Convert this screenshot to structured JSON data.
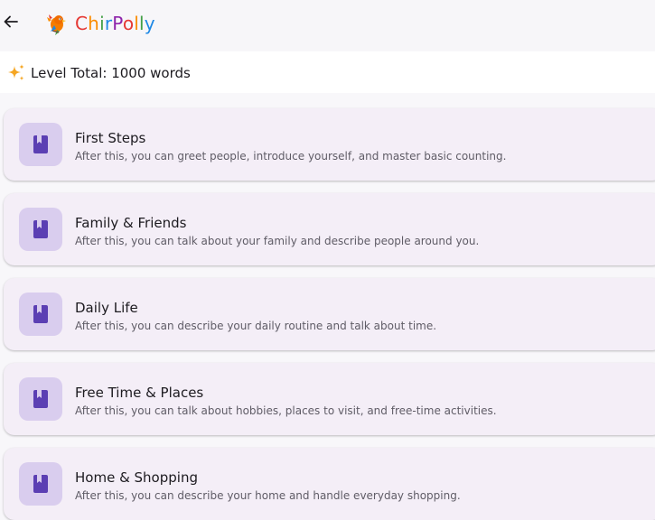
{
  "header": {
    "back_icon": "arrow-left-icon",
    "logo_icon": "parrot-logo-icon",
    "brand_letters": [
      {
        "char": "C",
        "color": "#e53935"
      },
      {
        "char": "h",
        "color": "#fb8c00"
      },
      {
        "char": "i",
        "color": "#43a047"
      },
      {
        "char": "r",
        "color": "#1e88e5"
      },
      {
        "char": "P",
        "color": "#8e24aa"
      },
      {
        "char": "o",
        "color": "#e53935"
      },
      {
        "char": "l",
        "color": "#fb8c00"
      },
      {
        "char": "l",
        "color": "#43a047"
      },
      {
        "char": "y",
        "color": "#1e88e5"
      }
    ]
  },
  "level": {
    "icon": "sparkle-icon",
    "text": "Level Total: 1000 words"
  },
  "colors": {
    "accent": "#5b3fb3",
    "icon_bg": "#d9cdee",
    "card_bg": "#f4eef7",
    "sparkle": "#f5a623"
  },
  "units": [
    {
      "title": "First Steps",
      "description": "After this, you can greet people, introduce yourself, and master basic counting.",
      "icon": "book-icon"
    },
    {
      "title": "Family & Friends",
      "description": "After this, you can talk about your family and describe people around you.",
      "icon": "book-icon"
    },
    {
      "title": "Daily Life",
      "description": "After this, you can describe your daily routine and talk about time.",
      "icon": "book-icon"
    },
    {
      "title": "Free Time & Places",
      "description": "After this, you can talk about hobbies, places to visit, and free-time activities.",
      "icon": "book-icon"
    },
    {
      "title": "Home & Shopping",
      "description": "After this, you can describe your home and handle everyday shopping.",
      "icon": "book-icon"
    }
  ]
}
